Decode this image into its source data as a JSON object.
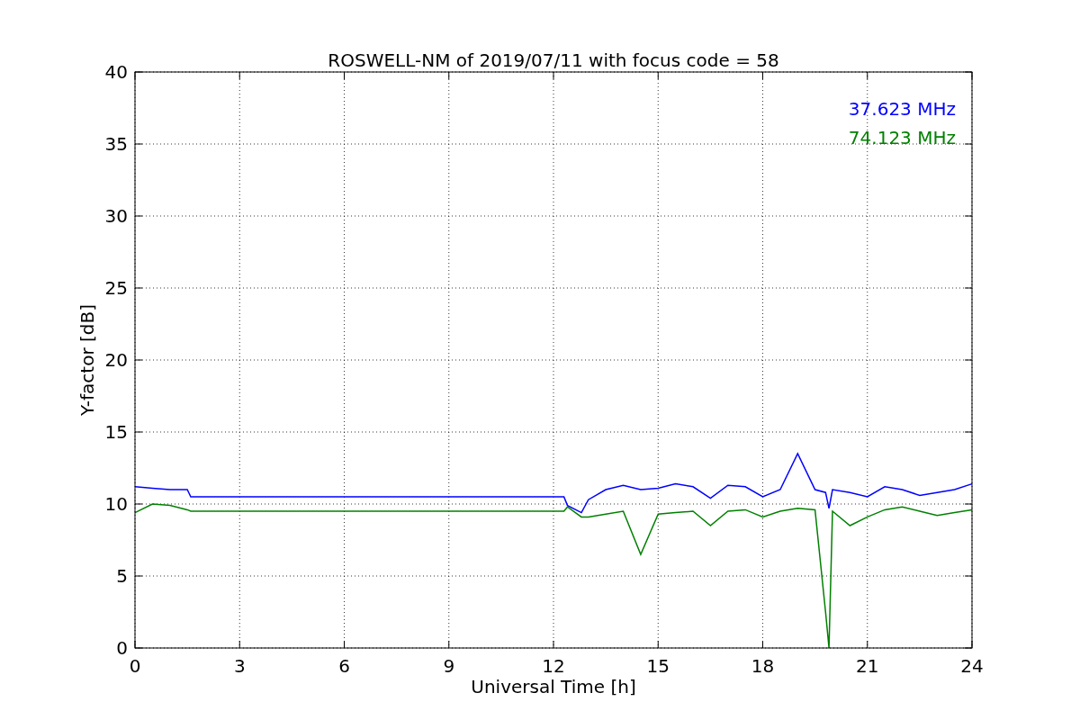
{
  "chart_data": {
    "type": "line",
    "title": "ROSWELL-NM of 2019/07/11 with focus code = 58",
    "xlabel": "Universal Time [h]",
    "ylabel": "Y-factor [dB]",
    "x": [
      0,
      0.5,
      1,
      1.5,
      1.6,
      12.3,
      12.4,
      12.8,
      13,
      13.5,
      14,
      14.5,
      15,
      15.5,
      16,
      16.5,
      17,
      17.5,
      18,
      18.5,
      19,
      19.5,
      19.8,
      19.9,
      20,
      20.5,
      21,
      21.5,
      22,
      22.5,
      23,
      23.5,
      24
    ],
    "series": [
      {
        "name": "37.623 MHz",
        "color": "#0000ff",
        "values": [
          11.2,
          11.1,
          11.0,
          11.0,
          10.5,
          10.5,
          9.9,
          9.4,
          10.3,
          11.0,
          11.3,
          11.0,
          11.1,
          11.4,
          11.2,
          10.4,
          11.3,
          11.2,
          10.5,
          11.0,
          13.5,
          11.0,
          10.8,
          9.7,
          11.0,
          10.8,
          10.5,
          11.2,
          11.0,
          10.6,
          10.8,
          11.0,
          11.4
        ]
      },
      {
        "name": "74.123 MHz",
        "color": "#008000",
        "values": [
          9.4,
          10.0,
          9.9,
          9.6,
          9.5,
          9.5,
          9.8,
          9.1,
          9.1,
          9.3,
          9.5,
          6.5,
          9.3,
          9.4,
          9.5,
          8.5,
          9.5,
          9.6,
          9.1,
          9.5,
          9.7,
          9.6,
          2.5,
          0,
          9.5,
          8.5,
          9.1,
          9.6,
          9.8,
          9.5,
          9.2,
          9.4,
          9.6
        ]
      }
    ],
    "xlim": [
      0,
      24
    ],
    "ylim": [
      0,
      40
    ],
    "xticks": [
      0,
      3,
      6,
      9,
      12,
      15,
      18,
      21,
      24
    ],
    "yticks": [
      0,
      5,
      10,
      15,
      20,
      25,
      30,
      35,
      40
    ],
    "grid": true
  }
}
